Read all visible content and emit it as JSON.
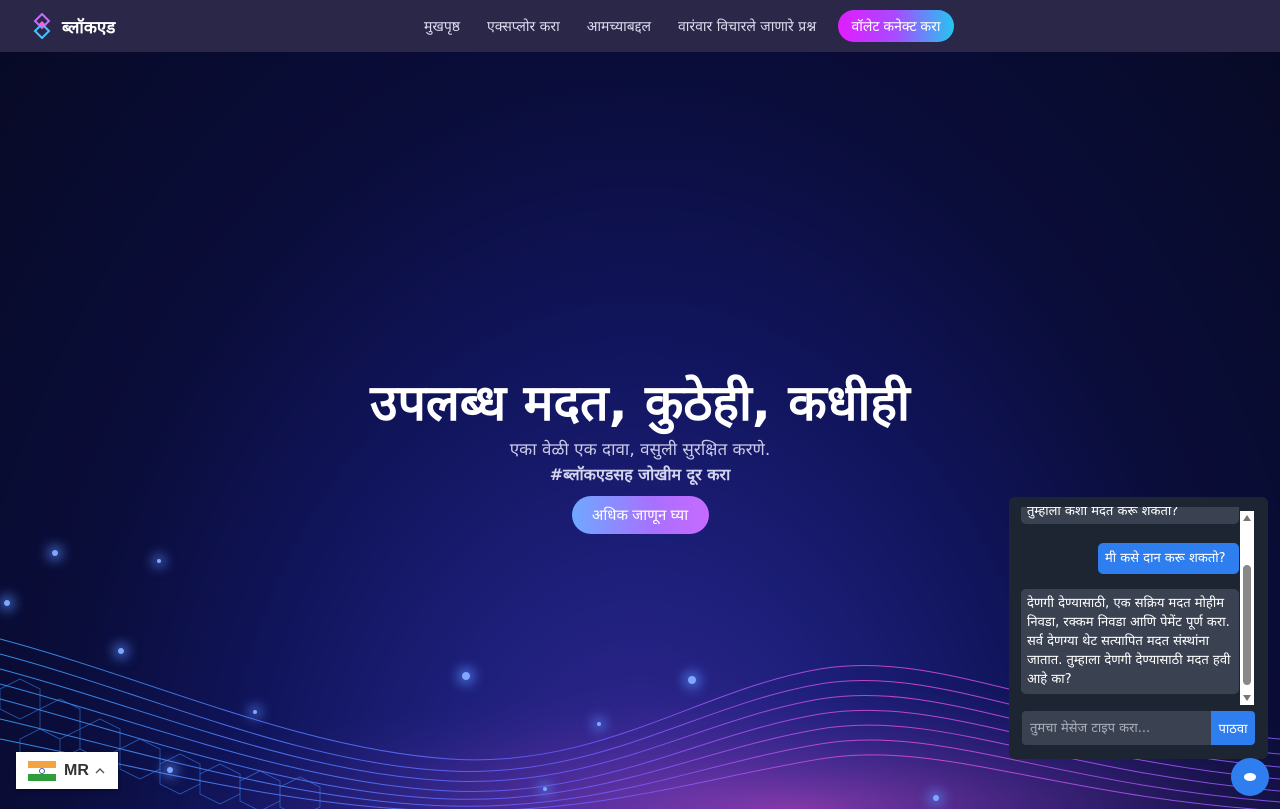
{
  "brand": {
    "name": "ब्लॉकएड"
  },
  "nav": {
    "links": [
      "मुखपृष्ठ",
      "एक्सप्लोर करा",
      "आमच्याबद्दल",
      "वारंवार विचारले जाणारे प्रश्न"
    ],
    "connect_label": "वॉलेट कनेक्ट करा"
  },
  "hero": {
    "title": "उपलब्ध मदत, कुठेही, कधीही",
    "subtitle": "एका वेळी एक दावा, वसुली सुरक्षित करणे.",
    "tagline": "#ब्लॉकएडसह जोखीम दूर करा",
    "cta": "अधिक जाणून घ्या"
  },
  "chat": {
    "messages": [
      {
        "from": "bot",
        "text": "तुम्हाला कशी मदत करू शकतो?"
      },
      {
        "from": "user",
        "text": "मी कसे दान करू शकतो?"
      },
      {
        "from": "bot",
        "text": "देणगी देण्यासाठी, एक सक्रिय मदत मोहीम निवडा, रक्कम निवडा आणि पेमेंट पूर्ण करा. सर्व देणग्या थेट सत्यापित मदत संस्थांना जातात. तुम्हाला देणगी देण्यासाठी मदत हवी आहे का?"
      }
    ],
    "input_placeholder": "तुमचा मेसेज टाइप करा...",
    "send_label": "पाठवा"
  },
  "language": {
    "code": "MR",
    "flag_icon": "india-flag-icon"
  },
  "colors": {
    "accent_blue": "#2f7ef0",
    "nav_bg": "#2b2748",
    "chat_bg": "#1e2532"
  }
}
